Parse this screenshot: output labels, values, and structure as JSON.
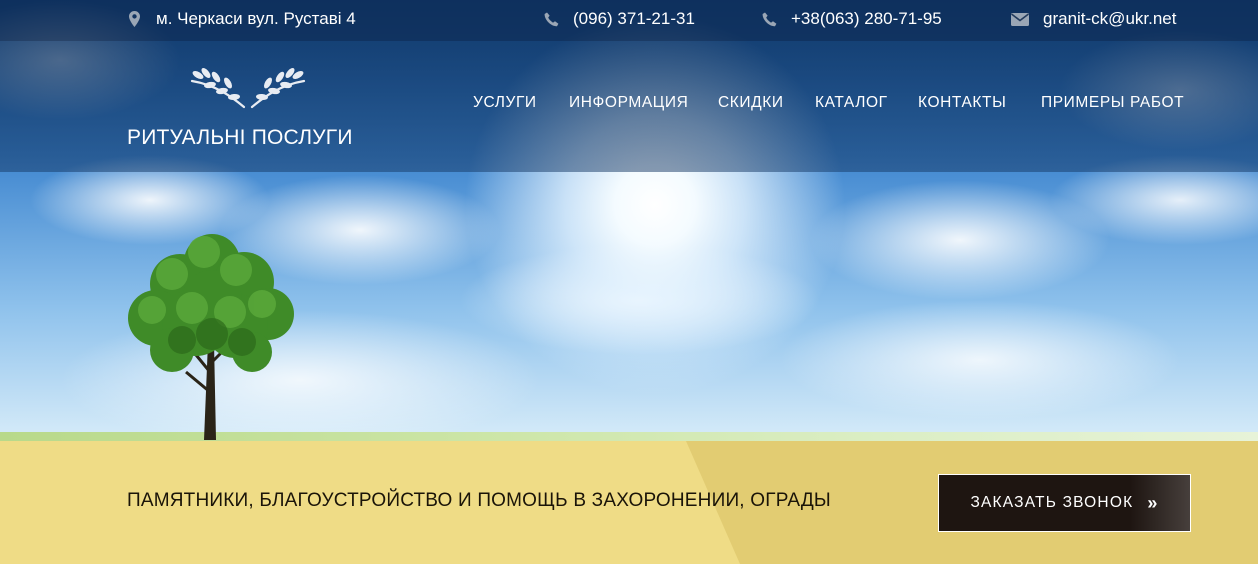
{
  "topbar": {
    "address": "м. Черкаси вул. Руставі 4",
    "phone1": "(096) 371-21-31",
    "phone2": "+38(063) 280-71-95",
    "email": "granit-ck@ukr.net",
    "icons": [
      "map-marker-icon",
      "phone-icon",
      "phone-icon",
      "envelope-icon"
    ]
  },
  "header": {
    "brand": "РИТУАЛЬНІ ПОСЛУГИ",
    "logo_icon": "wheat-wreath-icon"
  },
  "nav": {
    "items": [
      {
        "label": "УСЛУГИ"
      },
      {
        "label": "ИНФОРМАЦИЯ"
      },
      {
        "label": "СКИДКИ"
      },
      {
        "label": "КАТАЛОГ"
      },
      {
        "label": "КОНТАКТЫ"
      },
      {
        "label": "ПРИМЕРЫ РАБОТ"
      }
    ]
  },
  "band": {
    "tagline": "ПАМЯТНИКИ, БЛАГОУСТРОЙСТВО И ПОМОЩЬ В ЗАХОРОНЕНИИ, ОГРАДЫ",
    "cta_label": "ЗАКАЗАТЬ ЗВОНОК",
    "cta_icon": "double-chevron-right-icon"
  },
  "colors": {
    "band": "#efdc86",
    "band_dark": "#e2cc72",
    "cta_bg": "#1e1511",
    "topbar_bg": "#081e41"
  }
}
